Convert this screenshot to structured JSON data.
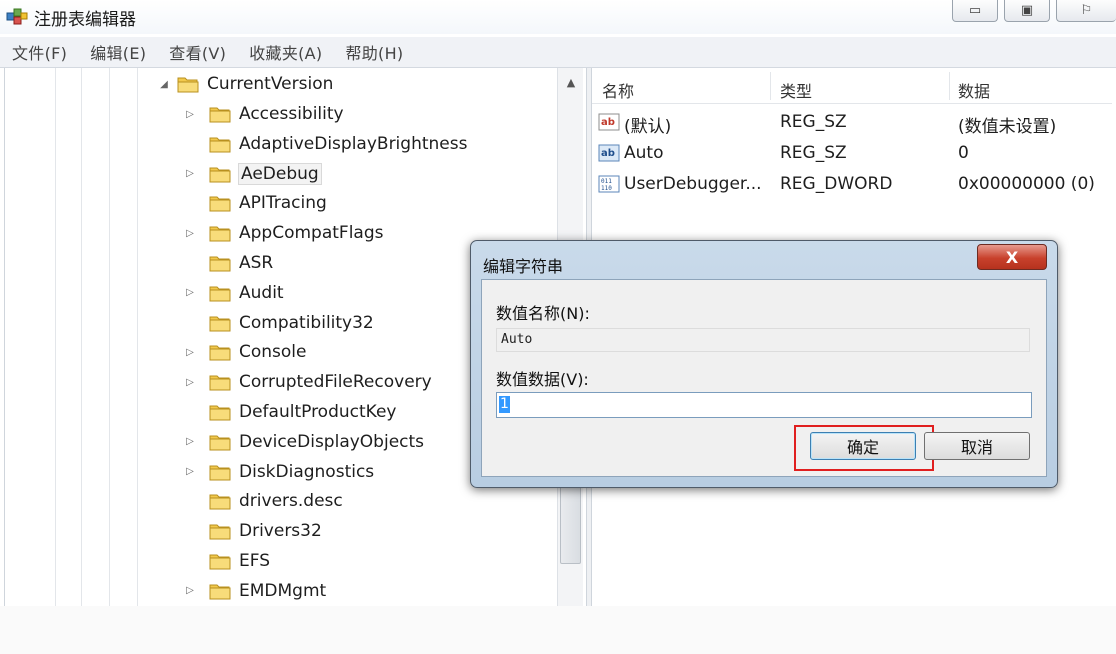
{
  "window": {
    "title": "注册表编辑器",
    "buttons": [
      "▭",
      "▣",
      "⚐"
    ]
  },
  "menu": [
    "文件(F)",
    "编辑(E)",
    "查看(V)",
    "收藏夹(A)",
    "帮助(H)"
  ],
  "tree": {
    "parent": "CurrentVersion",
    "items": [
      {
        "label": "Accessibility",
        "expandable": true
      },
      {
        "label": "AdaptiveDisplayBrightness",
        "expandable": false
      },
      {
        "label": "AeDebug",
        "expandable": true,
        "selected": true
      },
      {
        "label": "APITracing",
        "expandable": false
      },
      {
        "label": "AppCompatFlags",
        "expandable": true
      },
      {
        "label": "ASR",
        "expandable": false
      },
      {
        "label": "Audit",
        "expandable": true
      },
      {
        "label": "Compatibility32",
        "expandable": false
      },
      {
        "label": "Console",
        "expandable": true
      },
      {
        "label": "CorruptedFileRecovery",
        "expandable": true
      },
      {
        "label": "DefaultProductKey",
        "expandable": false
      },
      {
        "label": "DeviceDisplayObjects",
        "expandable": true
      },
      {
        "label": "DiskDiagnostics",
        "expandable": true
      },
      {
        "label": "drivers.desc",
        "expandable": false
      },
      {
        "label": "Drivers32",
        "expandable": false
      },
      {
        "label": "EFS",
        "expandable": false
      },
      {
        "label": "EMDMgmt",
        "expandable": true
      }
    ]
  },
  "values": {
    "headers": {
      "name": "名称",
      "type": "类型",
      "data": "数据"
    },
    "rows": [
      {
        "name": "(默认)",
        "type": "REG_SZ",
        "data": "(数值未设置)",
        "icon": "string-value-icon"
      },
      {
        "name": "Auto",
        "type": "REG_SZ",
        "data": "0",
        "icon": "string-value-icon"
      },
      {
        "name": "UserDebugger...",
        "type": "REG_DWORD",
        "data": "0x00000000 (0)",
        "icon": "binary-value-icon"
      }
    ]
  },
  "dialog": {
    "title": "编辑字符串",
    "close": "X",
    "name_label": "数值名称(N):",
    "name_value": "Auto",
    "data_label": "数值数据(V):",
    "data_value": "1",
    "ok": "确定",
    "cancel": "取消"
  },
  "colors": {
    "folder": "#f2c94c",
    "highlight": "#e01f1f",
    "close": "#c8412c"
  }
}
